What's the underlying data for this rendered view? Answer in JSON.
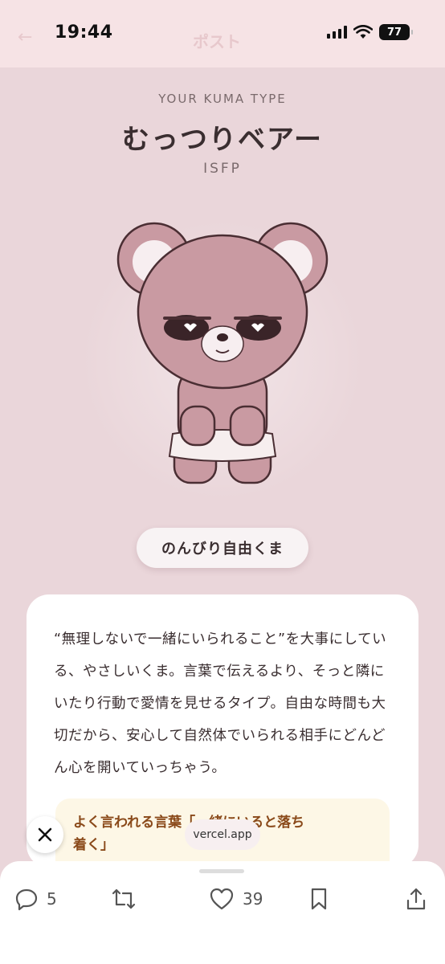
{
  "status_bar": {
    "time": "19:44",
    "battery": "77"
  },
  "header": {
    "faint_title": "ポスト"
  },
  "hero": {
    "type_label": "YOUR KUMA TYPE",
    "name": "むっつりベアー",
    "mbti": "ISFP"
  },
  "tag": {
    "label": "のんびり自由くま"
  },
  "card": {
    "description": "“無理しないで一緒にいられること”を大事にしている、やさしいくま。言葉で伝えるより、そっと隣にいたり行動で愛情を見せるタイプ。自由な時間も大切だから、安心して自然体でいられる相手にどんどん心を開いていっちゃう。",
    "quote_line1": "よく言われる言葉「一緒にいると落ち",
    "quote_line2": "着く」"
  },
  "browser": {
    "url": "vercel.app"
  },
  "actions": {
    "replies": "5",
    "likes": "39"
  },
  "colors": {
    "background": "#ead6da",
    "bear": "#c99aa2",
    "accent_text": "#8a4a1a"
  },
  "icons": [
    "close-icon",
    "reply-icon",
    "repost-icon",
    "like-icon",
    "bookmark-icon",
    "share-icon",
    "wifi-icon",
    "signal-icon"
  ]
}
